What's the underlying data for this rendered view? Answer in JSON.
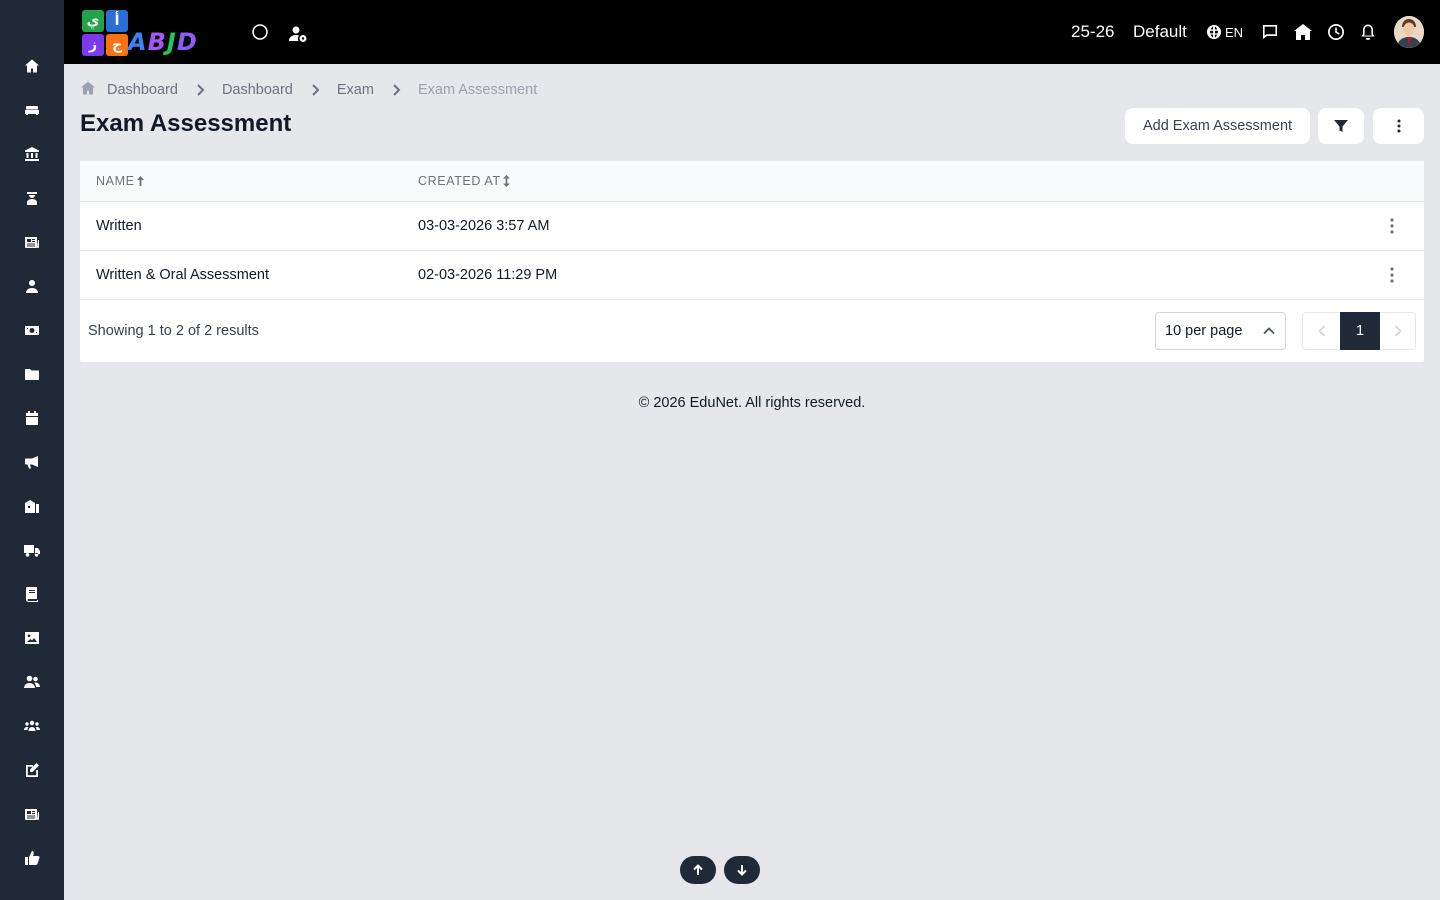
{
  "topbar": {
    "session": "25-26",
    "profile": "Default",
    "language": "EN"
  },
  "breadcrumb": [
    "Dashboard",
    "Dashboard",
    "Exam",
    "Exam Assessment"
  ],
  "page": {
    "title": "Exam Assessment",
    "add_button": "Add Exam Assessment"
  },
  "table": {
    "columns": [
      "NAME",
      "CREATED AT"
    ],
    "rows": [
      {
        "name": "Written",
        "created_at": "03-03-2026 3:57 AM"
      },
      {
        "name": "Written & Oral Assessment",
        "created_at": "02-03-2026 11:29 PM"
      }
    ],
    "showing": "Showing 1 to 2 of 2 results",
    "per_page": "10 per page",
    "current_page": "1"
  },
  "footer": "© 2026 EduNet. All rights reserved.",
  "logo": {
    "tiles": [
      "ي",
      "أ",
      "ز",
      "ج"
    ],
    "word": "ABJD"
  },
  "colors": {
    "sidebar": "#1f2937",
    "topbar": "#000000",
    "background": "#e5e7eb",
    "accent": "#1f2937"
  }
}
